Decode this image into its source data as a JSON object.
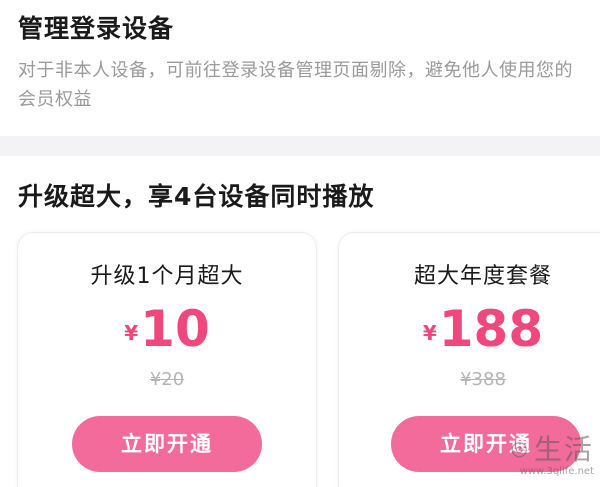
{
  "manage": {
    "title": "管理登录设备",
    "description": "对于非本人设备，可前往登录设备管理页面剔除，避免他人使用您的会员权益"
  },
  "upgrade": {
    "title": "升级超大，享4台设备同时播放"
  },
  "plans": [
    {
      "name": "升级1个月超大",
      "currency": "¥",
      "price": "10",
      "original_price": "¥20",
      "button_label": "立即开通"
    },
    {
      "name": "超大年度套餐",
      "currency": "¥",
      "price": "188",
      "original_price": "¥388",
      "button_label": "立即开通"
    }
  ],
  "watermark": {
    "text": "生活",
    "url": "www.3qlife.net"
  },
  "colors": {
    "accent": "#f0477d",
    "button": "#f36b9a",
    "divider": "#f3f3f5"
  }
}
